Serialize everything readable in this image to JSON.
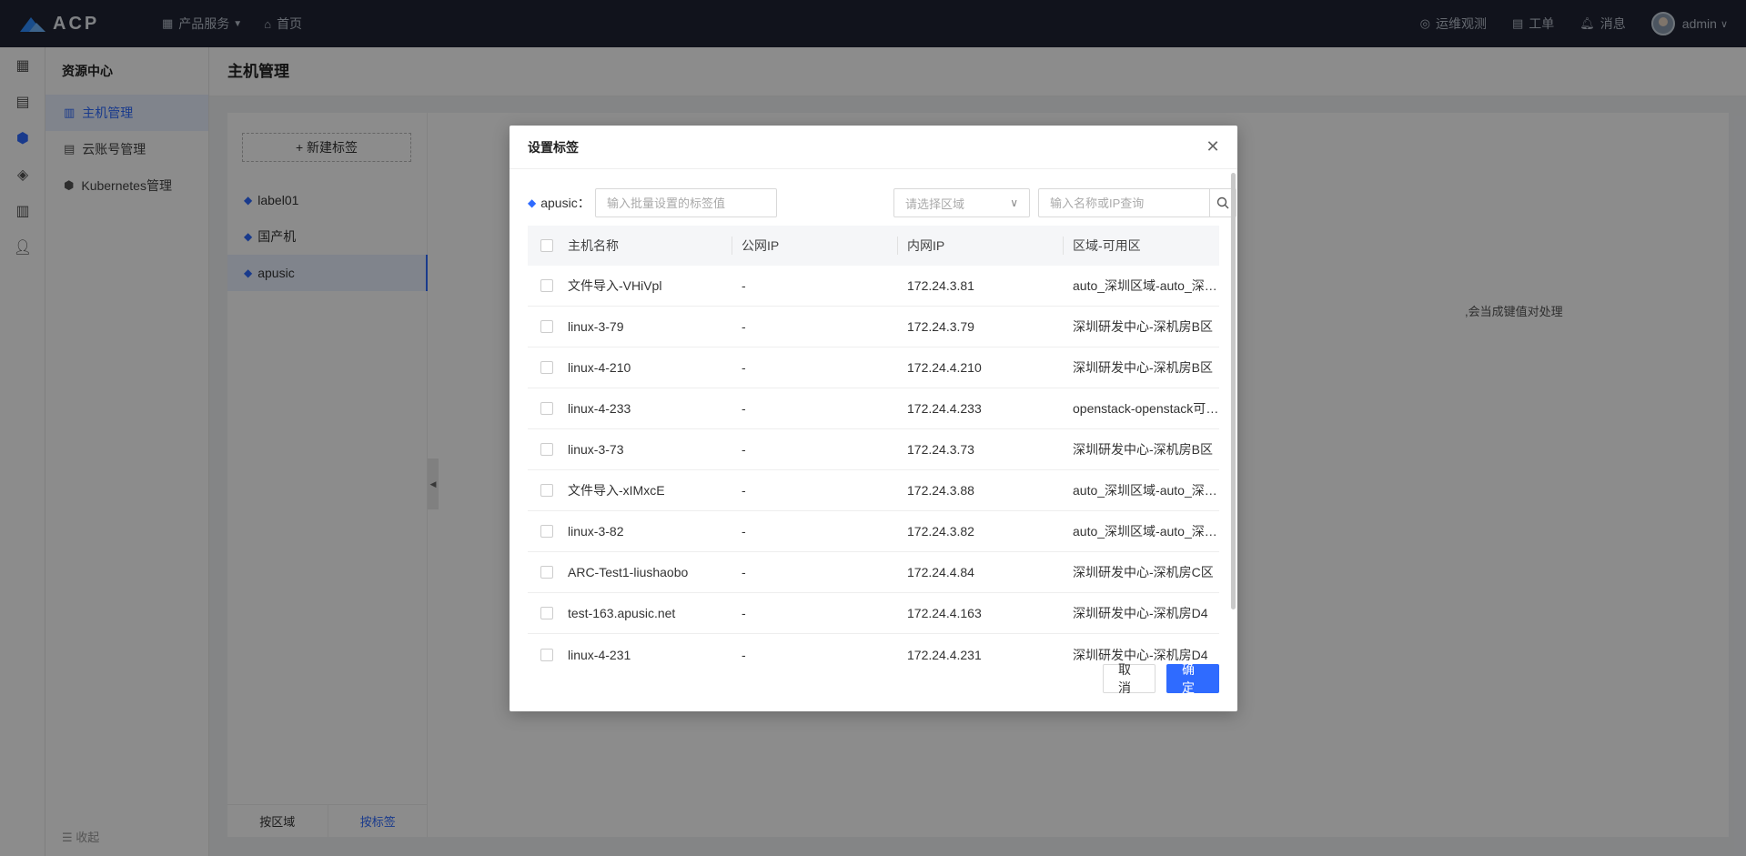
{
  "topbar": {
    "logo_text": "ACP",
    "product_menu": "产品服务",
    "home": "首页",
    "ops": "运维观测",
    "tickets": "工单",
    "messages": "消息",
    "user": "admin"
  },
  "sidebar": {
    "title": "资源中心",
    "items": [
      {
        "label": "主机管理",
        "icon": "host-icon"
      },
      {
        "label": "云账号管理",
        "icon": "account-icon"
      },
      {
        "label": "Kubernetes管理",
        "icon": "kubernetes-icon"
      }
    ],
    "collapse": "收起"
  },
  "page": {
    "title": "主机管理",
    "new_tag": "+ 新建标签",
    "labels": [
      "label01",
      "国产机",
      "apusic"
    ],
    "tabs": [
      "按区域",
      "按标签"
    ],
    "hint": ",会当成键值对处理"
  },
  "modal": {
    "title": "设置标签",
    "tag_name": "apusic：",
    "tag_placeholder": "输入批量设置的标签值",
    "region_placeholder": "请选择区域",
    "search_placeholder": "输入名称或IP查询",
    "columns": [
      "主机名称",
      "公网IP",
      "内网IP",
      "区域-可用区"
    ],
    "rows": [
      {
        "name": "文件导入-VHiVpl",
        "public_ip": "-",
        "private_ip": "172.24.3.81",
        "region": "auto_深圳区域-auto_深圳可用区"
      },
      {
        "name": "linux-3-79",
        "public_ip": "-",
        "private_ip": "172.24.3.79",
        "region": "深圳研发中心-深机房B区"
      },
      {
        "name": "linux-4-210",
        "public_ip": "-",
        "private_ip": "172.24.4.210",
        "region": "深圳研发中心-深机房B区"
      },
      {
        "name": "linux-4-233",
        "public_ip": "-",
        "private_ip": "172.24.4.233",
        "region": "openstack-openstack可用区"
      },
      {
        "name": "linux-3-73",
        "public_ip": "-",
        "private_ip": "172.24.3.73",
        "region": "深圳研发中心-深机房B区"
      },
      {
        "name": "文件导入-xIMxcE",
        "public_ip": "-",
        "private_ip": "172.24.3.88",
        "region": "auto_深圳区域-auto_深圳可用区"
      },
      {
        "name": "linux-3-82",
        "public_ip": "-",
        "private_ip": "172.24.3.82",
        "region": "auto_深圳区域-auto_深圳可用区"
      },
      {
        "name": "ARC-Test1-liushaobo",
        "public_ip": "-",
        "private_ip": "172.24.4.84",
        "region": "深圳研发中心-深机房C区"
      },
      {
        "name": "test-163.apusic.net",
        "public_ip": "-",
        "private_ip": "172.24.4.163",
        "region": "深圳研发中心-深机房D4"
      },
      {
        "name": "linux-4-231",
        "public_ip": "-",
        "private_ip": "172.24.4.231",
        "region": "深圳研发中心-深机房D4"
      }
    ],
    "cancel": "取 消",
    "ok": "确 定"
  }
}
